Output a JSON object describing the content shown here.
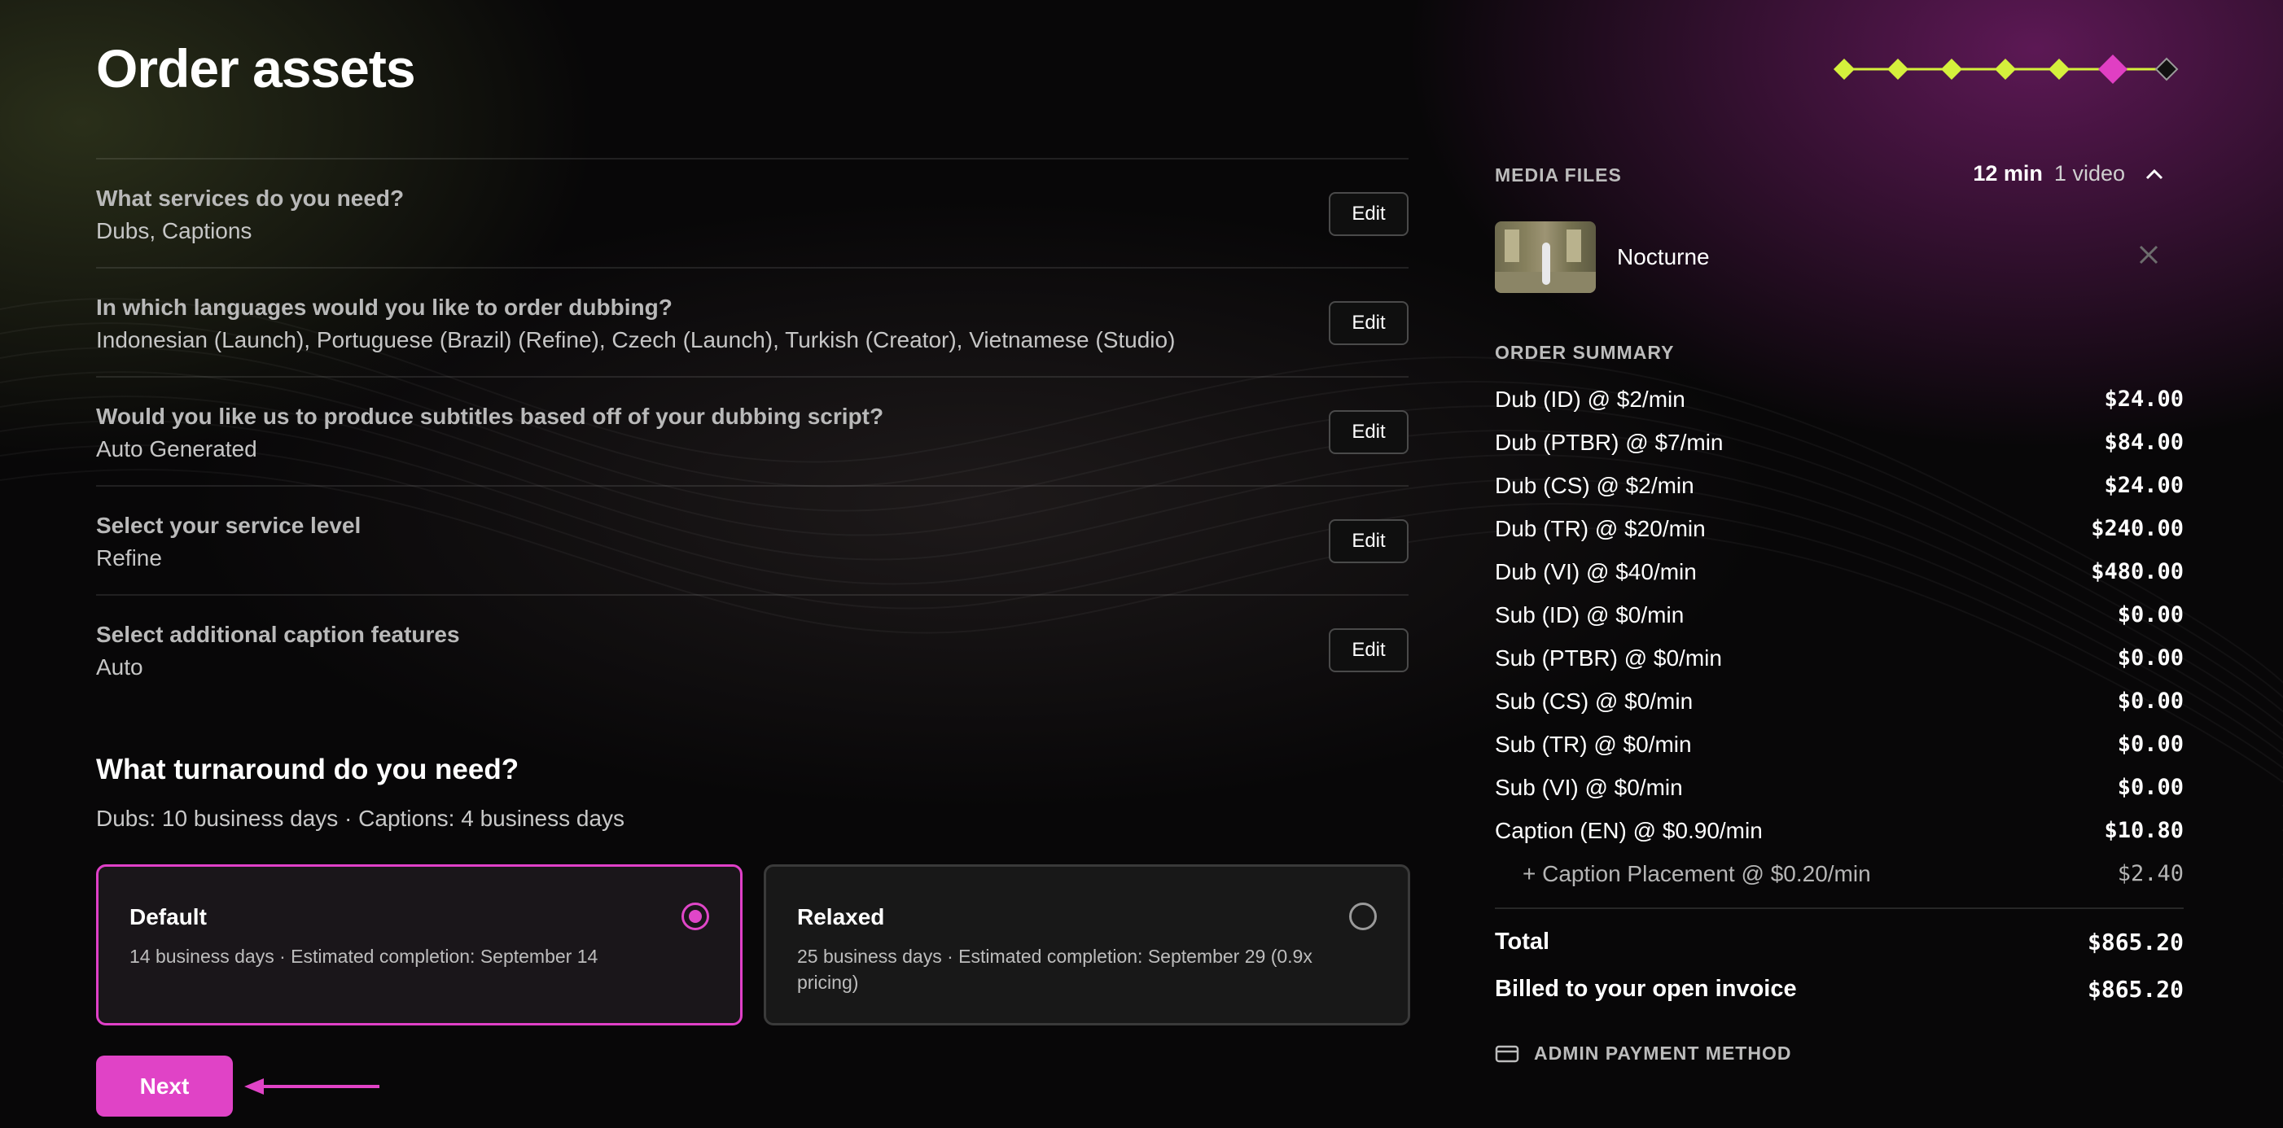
{
  "page": {
    "title": "Order assets"
  },
  "stepper": {
    "completed_steps": 5,
    "current_step": 6,
    "total_steps": 7,
    "done_color": "#d5f03c",
    "current_color": "#e03fc3"
  },
  "questions": [
    {
      "question": "What services do you need?",
      "answer": "Dubs, Captions",
      "edit_label": "Edit"
    },
    {
      "question": "In which languages would you like to order dubbing?",
      "answer": "Indonesian (Launch), Portuguese (Brazil) (Refine), Czech (Launch), Turkish (Creator), Vietnamese (Studio)",
      "edit_label": "Edit"
    },
    {
      "question": "Would you like us to produce subtitles based off of your dubbing script?",
      "answer": "Auto Generated",
      "edit_label": "Edit"
    },
    {
      "question": "Select your service level",
      "answer": "Refine",
      "edit_label": "Edit"
    },
    {
      "question": "Select additional caption features",
      "answer": "Auto",
      "edit_label": "Edit"
    }
  ],
  "turnaround": {
    "title": "What turnaround do you need?",
    "subtitle": "Dubs: 10 business days · Captions: 4 business days",
    "options": [
      {
        "name": "Default",
        "description": "14 business days · Estimated completion: September 14",
        "selected": true
      },
      {
        "name": "Relaxed",
        "description": "25 business days · Estimated completion: September 29 (0.9x pricing)",
        "selected": false
      }
    ]
  },
  "actions": {
    "next_label": "Next"
  },
  "media": {
    "label": "MEDIA FILES",
    "duration": "12 min",
    "count": "1 video",
    "files": [
      {
        "name": "Nocturne"
      }
    ]
  },
  "summary": {
    "label": "ORDER SUMMARY",
    "lines": [
      {
        "label": "Dub (ID) @ $2/min",
        "amount": "$24.00"
      },
      {
        "label": "Dub (PTBR) @ $7/min",
        "amount": "$84.00"
      },
      {
        "label": "Dub (CS) @ $2/min",
        "amount": "$24.00"
      },
      {
        "label": "Dub (TR) @ $20/min",
        "amount": "$240.00"
      },
      {
        "label": "Dub (VI) @ $40/min",
        "amount": "$480.00"
      },
      {
        "label": "Sub (ID) @ $0/min",
        "amount": "$0.00"
      },
      {
        "label": "Sub (PTBR) @ $0/min",
        "amount": "$0.00"
      },
      {
        "label": "Sub (CS) @ $0/min",
        "amount": "$0.00"
      },
      {
        "label": "Sub (TR) @ $0/min",
        "amount": "$0.00"
      },
      {
        "label": "Sub (VI) @ $0/min",
        "amount": "$0.00"
      },
      {
        "label": "Caption (EN) @ $0.90/min",
        "amount": "$10.80"
      },
      {
        "label": "+ Caption Placement @ $0.20/min",
        "amount": "$2.40",
        "sub": true
      }
    ],
    "total_label": "Total",
    "total_amount": "$865.20",
    "billed_label": "Billed to your open invoice",
    "billed_amount": "$865.20"
  },
  "payment": {
    "label": "ADMIN PAYMENT METHOD",
    "icon": "credit-card-icon"
  }
}
